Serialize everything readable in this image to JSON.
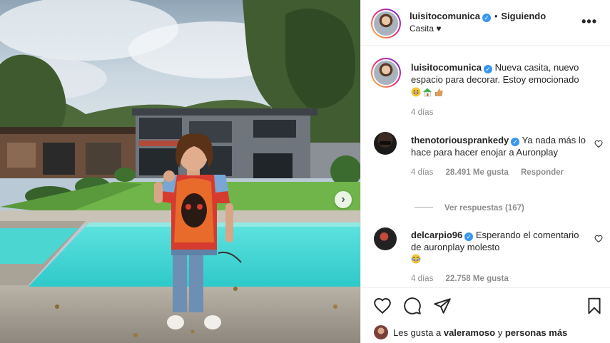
{
  "post": {
    "username": "luisitocomunica",
    "follow_status": "Siguiendo",
    "location": "Casita ♥",
    "caption": "Nueva casita, nuevo espacio para decorar. Estoy emocionado",
    "caption_emojis": "😁🏠👍",
    "time": "4 días"
  },
  "comments": [
    {
      "username": "thenotoriousprankedy",
      "text": "Ya nada más lo hace para hacer enojar a Auronplay",
      "time": "4 días",
      "likes": "28.491 Me gusta",
      "reply": "Responder",
      "view_replies": "Ver respuestas (167)"
    },
    {
      "username": "delcarpio96",
      "text": "Esperando el comentario de auronplay molesto",
      "emoji": "😂",
      "time": "4 días",
      "likes": "22.758 Me gusta"
    }
  ],
  "likes_line": {
    "prefix": "Les gusta a",
    "user": "valeramoso",
    "connector": "y",
    "rest": "personas más"
  },
  "icons": {
    "verified": "verified-badge-icon",
    "more": "more-options-icon",
    "like": "heart-icon",
    "comment": "comment-icon",
    "share": "paper-plane-icon",
    "save": "bookmark-icon",
    "next": "chevron-right-icon"
  },
  "colors": {
    "verified": "#3897f0",
    "text": "#262626",
    "muted": "#8e8e8e",
    "pool": "#3fd9d6"
  }
}
